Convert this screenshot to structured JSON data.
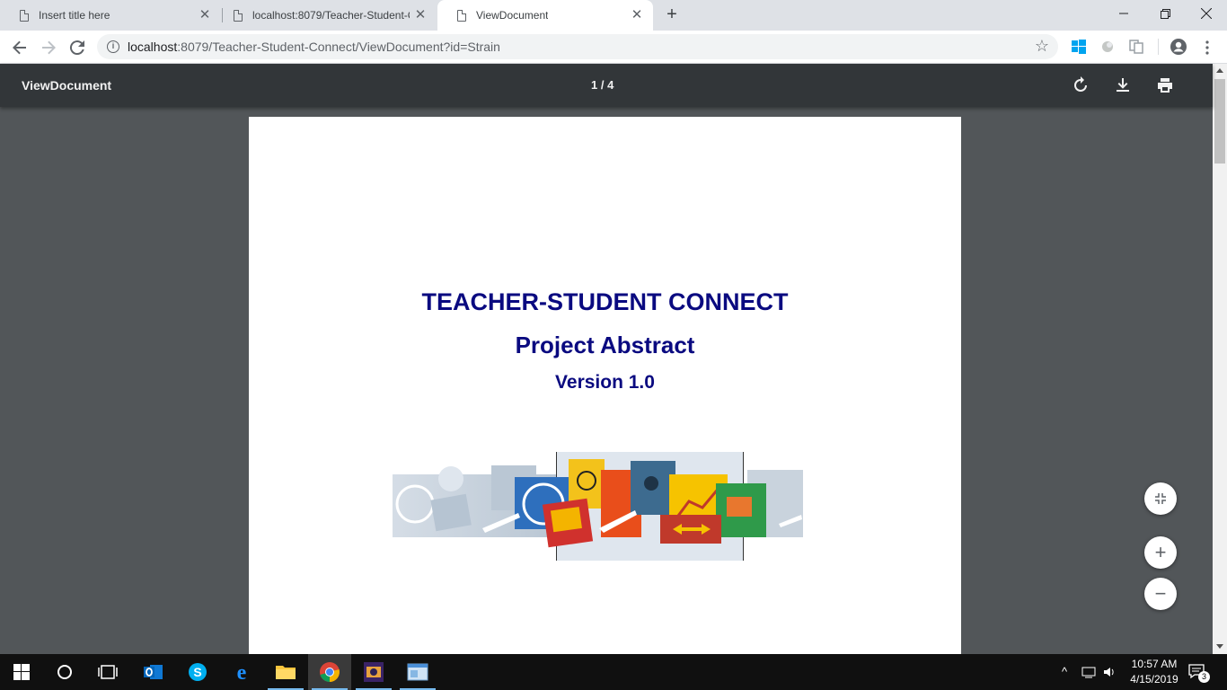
{
  "tabs": [
    {
      "title": "Insert title here"
    },
    {
      "title": "localhost:8079/Teacher-Student-C"
    },
    {
      "title": "ViewDocument"
    }
  ],
  "address": {
    "host": "localhost",
    "rest": ":8079/Teacher-Student-Connect/ViewDocument?id=Strain"
  },
  "pdf_toolbar": {
    "title": "ViewDocument",
    "current_page": "1",
    "separator": "/",
    "total_pages": "4"
  },
  "document": {
    "heading": "TEACHER-STUDENT CONNECT",
    "subheading": "Project Abstract",
    "version": "Version 1.0"
  },
  "taskbar": {
    "time": "10:57 AM",
    "date": "4/15/2019",
    "notification_count": "3"
  },
  "colors": {
    "title_text": "#0a0a80",
    "viewer_bg": "#525659",
    "pdf_toolbar_bg": "#323639"
  }
}
